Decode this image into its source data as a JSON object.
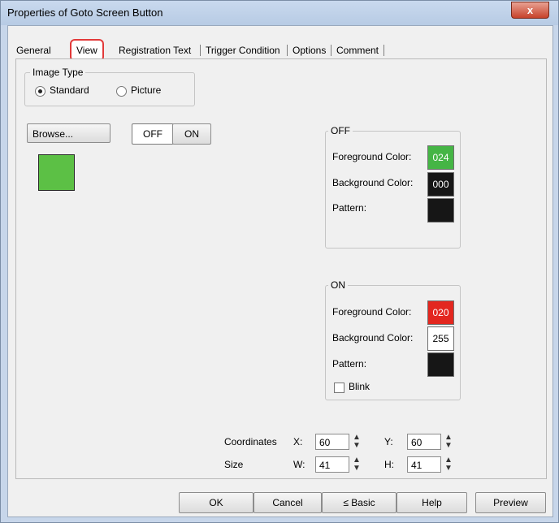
{
  "window": {
    "title": "Properties of Goto Screen Button",
    "close_label": "x"
  },
  "tabs": [
    {
      "label": "General",
      "active": false
    },
    {
      "label": "View",
      "active": true
    },
    {
      "label": "Registration Text",
      "active": false
    },
    {
      "label": "Trigger Condition",
      "active": false
    },
    {
      "label": "Options",
      "active": false
    },
    {
      "label": "Comment",
      "active": false
    }
  ],
  "image_type": {
    "legend": "Image Type",
    "standard_label": "Standard",
    "picture_label": "Picture",
    "selected": "Standard"
  },
  "browse_label": "Browse...",
  "state_toggle": {
    "off_label": "OFF",
    "on_label": "ON",
    "selected": "OFF"
  },
  "preview": {
    "color": "#5cc045"
  },
  "off_group": {
    "legend": "OFF",
    "fg_label": "Foreground Color:",
    "fg_value": "024",
    "fg_color": "#45b545",
    "bg_label": "Background Color:",
    "bg_value": "000",
    "bg_color": "#161616",
    "pattern_label": "Pattern:",
    "pattern_color": "#161616"
  },
  "on_group": {
    "legend": "ON",
    "fg_label": "Foreground Color:",
    "fg_value": "020",
    "fg_color": "#e3271f",
    "bg_label": "Background Color:",
    "bg_value": "255",
    "bg_color": "#ffffff",
    "pattern_label": "Pattern:",
    "pattern_color": "#161616",
    "blink_label": "Blink",
    "blink_checked": false
  },
  "coordinates": {
    "label": "Coordinates",
    "x_label": "X:",
    "x_value": "60",
    "y_label": "Y:",
    "y_value": "60"
  },
  "size": {
    "label": "Size",
    "w_label": "W:",
    "w_value": "41",
    "h_label": "H:",
    "h_value": "41"
  },
  "buttons": {
    "ok": "OK",
    "cancel": "Cancel",
    "basic": "≤ Basic",
    "help": "Help",
    "preview": "Preview"
  }
}
